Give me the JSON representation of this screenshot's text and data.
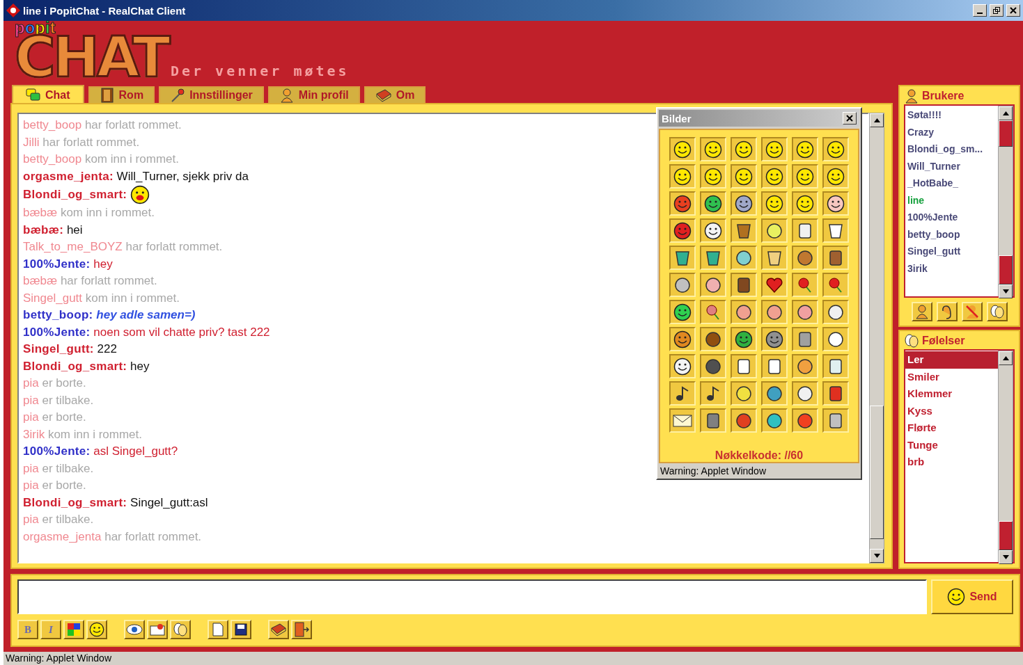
{
  "window": {
    "title": "line i PopitChat - RealChat Client"
  },
  "logo": {
    "small": "popit",
    "main": "CHAT",
    "tagline": "Der venner møtes"
  },
  "tabs": [
    {
      "label": "Chat",
      "selected": true
    },
    {
      "label": "Rom",
      "selected": false
    },
    {
      "label": "Innstillinger",
      "selected": false
    },
    {
      "label": "Min profil",
      "selected": false
    },
    {
      "label": "Om",
      "selected": false
    }
  ],
  "chat_log": [
    {
      "kind": "event",
      "user": "betty_boop",
      "text": "har forlatt rommet."
    },
    {
      "kind": "event",
      "user": "Jilli",
      "text": "har forlatt rommet."
    },
    {
      "kind": "event",
      "user": "betty_boop",
      "text": "kom inn i rommet."
    },
    {
      "kind": "message",
      "user": "orgasme_jenta:",
      "color": "#d02030",
      "body": {
        "kind": "plain",
        "text": "Will_Turner, sjekk priv da"
      }
    },
    {
      "kind": "emoticon",
      "user": "Blondi_og_smart:",
      "color": "#d02030"
    },
    {
      "kind": "event",
      "user": "bæbæ",
      "text": "kom inn i rommet."
    },
    {
      "kind": "message",
      "user": "bæbæ:",
      "color": "#d02030",
      "body": {
        "kind": "plain",
        "text": "hei"
      }
    },
    {
      "kind": "event",
      "user": "Talk_to_me_BOYZ",
      "text": "har forlatt rommet."
    },
    {
      "kind": "message",
      "user": "100%Jente:",
      "color": "#3030c8",
      "body": {
        "kind": "red",
        "text": "hey"
      }
    },
    {
      "kind": "event",
      "user": "bæbæ",
      "text": "har forlatt rommet."
    },
    {
      "kind": "event",
      "user": "Singel_gutt",
      "text": "kom inn i rommet."
    },
    {
      "kind": "message",
      "user": "betty_boop:",
      "color": "#3030c8",
      "body": {
        "kind": "emphasis",
        "text": "hey adle samen=)"
      }
    },
    {
      "kind": "message",
      "user": "100%Jente:",
      "color": "#3030c8",
      "body": {
        "kind": "red",
        "text": "noen som vil chatte priv? tast 222"
      }
    },
    {
      "kind": "message",
      "user": "Singel_gutt:",
      "color": "#d02030",
      "body": {
        "kind": "plain",
        "text": "222"
      }
    },
    {
      "kind": "message",
      "user": "Blondi_og_smart:",
      "color": "#d02030",
      "body": {
        "kind": "plain",
        "text": "hey"
      }
    },
    {
      "kind": "event",
      "user": "pia",
      "text": "er borte."
    },
    {
      "kind": "event",
      "user": "pia",
      "text": "er tilbake."
    },
    {
      "kind": "event",
      "user": "pia",
      "text": "er borte."
    },
    {
      "kind": "event",
      "user": "3irik",
      "text": "kom inn i rommet."
    },
    {
      "kind": "message",
      "user": "100%Jente:",
      "color": "#3030c8",
      "body": {
        "kind": "red",
        "text": "asl Singel_gutt?"
      }
    },
    {
      "kind": "event",
      "user": "pia",
      "text": "er tilbake."
    },
    {
      "kind": "event",
      "user": "pia",
      "text": "er borte."
    },
    {
      "kind": "message",
      "user": "Blondi_og_smart:",
      "color": "#d02030",
      "body": {
        "kind": "plain",
        "text": "Singel_gutt:asl"
      }
    },
    {
      "kind": "event",
      "user": "pia",
      "text": "er tilbake."
    },
    {
      "kind": "event",
      "user": "orgasme_jenta",
      "text": "har forlatt rommet."
    }
  ],
  "pictures_window": {
    "title": "Bilder",
    "key_code": "Nøkkelkode: //60",
    "warning": "Warning: Applet Window"
  },
  "users_panel": {
    "title": "Brukere",
    "users": [
      {
        "name": "Søta!!!!",
        "color": "#4a4a78"
      },
      {
        "name": "Crazy",
        "color": "#4a4a78"
      },
      {
        "name": "Blondi_og_sm...",
        "color": "#4a4a78"
      },
      {
        "name": "Will_Turner",
        "color": "#4a4a78"
      },
      {
        "name": "_HotBabe_",
        "color": "#4a4a78"
      },
      {
        "name": "line",
        "color": "#14a03c"
      },
      {
        "name": "100%Jente",
        "color": "#4a4a78"
      },
      {
        "name": "betty_boop",
        "color": "#4a4a78"
      },
      {
        "name": "Singel_gutt",
        "color": "#4a4a78"
      },
      {
        "name": "3irik",
        "color": "#4a4a78"
      }
    ]
  },
  "feelings_panel": {
    "title": "Følelser",
    "items": [
      {
        "label": "Ler",
        "selected": true
      },
      {
        "label": "Smiler",
        "selected": false
      },
      {
        "label": "Klemmer",
        "selected": false
      },
      {
        "label": "Kyss",
        "selected": false
      },
      {
        "label": "Flørte",
        "selected": false
      },
      {
        "label": "Tunge",
        "selected": false
      },
      {
        "label": "brb",
        "selected": false
      }
    ]
  },
  "composer": {
    "send": "Send",
    "format_buttons": [
      {
        "label": "B",
        "disabled": true
      },
      {
        "label": "I",
        "disabled": true
      }
    ]
  },
  "status_bar": "Warning: Applet Window"
}
